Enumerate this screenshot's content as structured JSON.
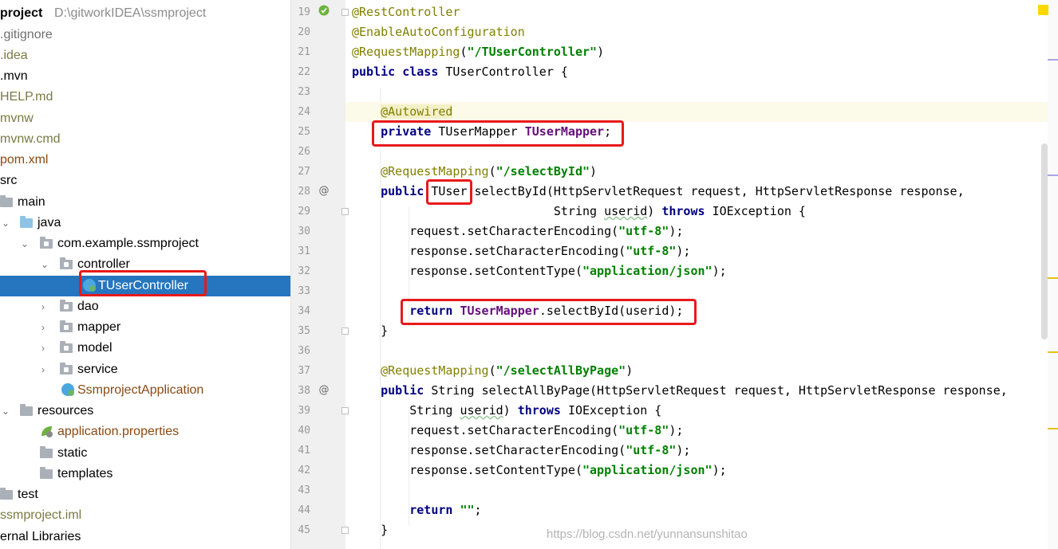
{
  "project_tree": {
    "rows": [
      {
        "label": "project",
        "extra": "D:\\gitworkIDEA\\ssmproject",
        "style": "root"
      },
      {
        "label": ".gitignore",
        "style": "gray"
      },
      {
        "label": ".idea",
        "style": "olive"
      },
      {
        "label": ".mvn",
        "style": "plain"
      },
      {
        "label": "HELP.md",
        "style": "olive"
      },
      {
        "label": "mvnw",
        "style": "olive"
      },
      {
        "label": "mvnw.cmd",
        "style": "olive"
      },
      {
        "label": "pom.xml",
        "style": "brown"
      },
      {
        "label": "src",
        "style": "plain"
      },
      {
        "label": "main",
        "style": "plain"
      },
      {
        "label": "java",
        "style": "plain"
      },
      {
        "label": "com.example.ssmproject",
        "style": "plain"
      },
      {
        "label": "controller",
        "style": "plain"
      },
      {
        "label": "TUserController",
        "style": "selected"
      },
      {
        "label": "dao",
        "style": "plain"
      },
      {
        "label": "mapper",
        "style": "plain"
      },
      {
        "label": "model",
        "style": "plain"
      },
      {
        "label": "service",
        "style": "plain"
      },
      {
        "label": "SsmprojectApplication",
        "style": "brown"
      },
      {
        "label": "resources",
        "style": "plain"
      },
      {
        "label": "application.properties",
        "style": "brown"
      },
      {
        "label": "static",
        "style": "plain"
      },
      {
        "label": "templates",
        "style": "plain"
      },
      {
        "label": "test",
        "style": "plain"
      },
      {
        "label": "ssmproject.iml",
        "style": "olive"
      },
      {
        "label": "ernal Libraries",
        "style": "plain"
      }
    ]
  },
  "editor": {
    "lines": [
      {
        "num": "19"
      },
      {
        "num": "20"
      },
      {
        "num": "21"
      },
      {
        "num": "22"
      },
      {
        "num": "23"
      },
      {
        "num": "24"
      },
      {
        "num": "25"
      },
      {
        "num": "26"
      },
      {
        "num": "27"
      },
      {
        "num": "28"
      },
      {
        "num": "29"
      },
      {
        "num": "30"
      },
      {
        "num": "31"
      },
      {
        "num": "32"
      },
      {
        "num": "33"
      },
      {
        "num": "34"
      },
      {
        "num": "35"
      },
      {
        "num": "36"
      },
      {
        "num": "37"
      },
      {
        "num": "38"
      },
      {
        "num": "39"
      },
      {
        "num": "40"
      },
      {
        "num": "41"
      },
      {
        "num": "42"
      },
      {
        "num": "43"
      },
      {
        "num": "44"
      },
      {
        "num": "45"
      }
    ],
    "tokens": {
      "rest_controller": "@RestController",
      "enable_auto": "@EnableAutoConfiguration",
      "request_mapping": "@RequestMapping",
      "controller_path": "\"/TUserController\"",
      "public": "public",
      "class": "class",
      "class_name": "TUserController {",
      "autowired": "@Autowired",
      "private": "private",
      "mapper_type": "TUserMapper",
      "mapper_field": "TUserMapper",
      "select_path": "\"/selectById\"",
      "return_type": "TUser",
      "select_sig": "selectById(HttpServletRequest request, HttpServletResponse response,",
      "string_type": "String",
      "userid": "userid",
      "throws": "throws",
      "io_exception": "IOException {",
      "set_char_req": "request.setCharacterEncoding(",
      "set_char_resp": "response.setCharacterEncoding(",
      "utf8": "\"utf-8\"",
      "set_content": "response.setContentType(",
      "json": "\"application/json\"",
      "return": "return",
      "select_call": ".selectById(userid);",
      "close_brace": "}",
      "select_all_path": "\"/selectAllByPage\"",
      "select_all_sig": "selectAllByPage(HttpServletRequest request, HttpServletResponse response,",
      "empty_str": "\"\""
    }
  },
  "watermark": "https://blog.csdn.net/yunnansunshitao",
  "colors": {
    "selection": "#2675bf",
    "highlight_box": "#e8191a",
    "keyword": "#000080",
    "annotation": "#808000",
    "string": "#008000",
    "field": "#660e7a"
  }
}
